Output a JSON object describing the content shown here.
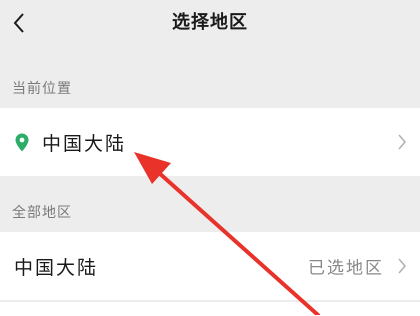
{
  "header": {
    "title": "选择地区",
    "back_icon": "chevron-left-icon"
  },
  "current_location": {
    "section_label": "当前位置",
    "region": "中国大陆",
    "icon": "location-pin-icon",
    "icon_color": "#2aae67"
  },
  "all_regions": {
    "section_label": "全部地区",
    "items": [
      {
        "label": "中国大陆",
        "status": "已选地区"
      }
    ]
  },
  "colors": {
    "background": "#ededed",
    "row_background": "#ffffff",
    "annotation_arrow": "#e8322a"
  }
}
